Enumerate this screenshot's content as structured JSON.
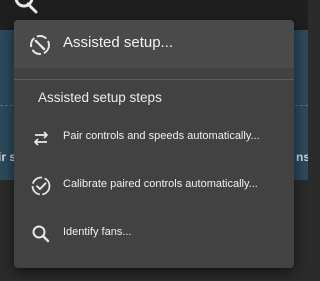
{
  "background": {
    "left_fragment": "ir s",
    "right_fragment": "ns"
  },
  "menu": {
    "primary_item": {
      "label": "Assisted setup...",
      "icon": "setup-wand-icon"
    },
    "section_title": "Assisted setup steps",
    "items": [
      {
        "label": "Pair controls and speeds automatically...",
        "icon": "swap-arrows-icon"
      },
      {
        "label": "Calibrate paired controls automatically...",
        "icon": "check-circle-dashed-icon"
      },
      {
        "label": "Identify fans...",
        "icon": "search-icon"
      }
    ]
  },
  "colors": {
    "menu_bg": "#424242",
    "highlight_bg": "#4a4a4a",
    "text": "#f0f0f0",
    "app_bg": "#2d4a5c"
  }
}
